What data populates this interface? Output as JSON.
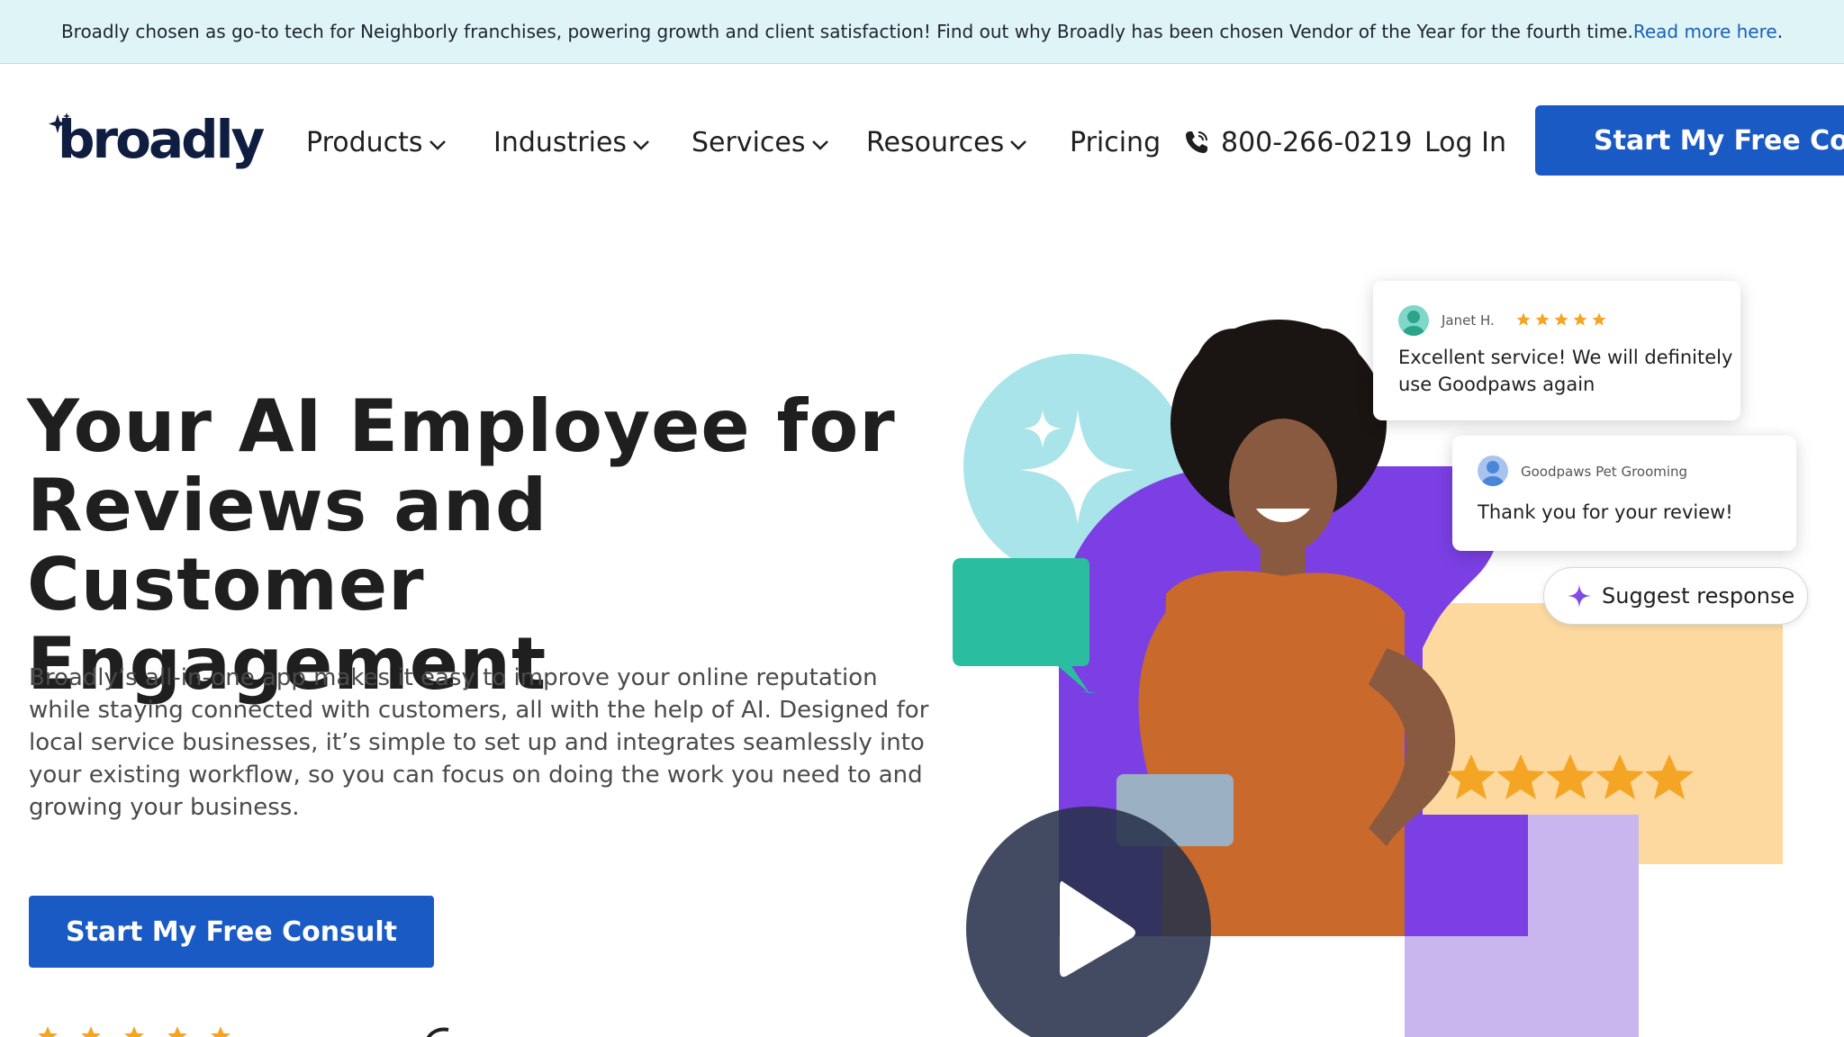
{
  "banner": {
    "text": "Broadly chosen as go-to tech for Neighborly franchises, powering growth and client satisfaction! Find out why Broadly has been chosen Vendor of the Year for the fourth time. ",
    "link": "Read more here",
    "suffix": "."
  },
  "nav": {
    "logo_text": "broadly",
    "items": [
      {
        "label": "Products"
      },
      {
        "label": "Industries"
      },
      {
        "label": "Services"
      },
      {
        "label": "Resources"
      },
      {
        "label": "Pricing"
      }
    ],
    "phone": "800-266-0219",
    "login": "Log In",
    "cta": "Start My Free Consult"
  },
  "hero": {
    "headline_lines": [
      "Your AI Employee for",
      "Reviews and Customer",
      "Engagement"
    ],
    "subcopy": "Broadly’s all-in-one app makes it easy to improve your online reputation while staying connected with customers, all with the help of AI. Designed for local service businesses, it’s simple to set up and integrates seamlessly into your existing workflow, so you can focus on doing the work you need to and growing your business.",
    "cta": "Start My Free Consult"
  },
  "illustration": {
    "review_card": {
      "name": "Janet H.",
      "rating": 5,
      "text_line1": "Excellent service! We will definitely",
      "text_line2": "use Goodpaws again"
    },
    "reply_card": {
      "name": "Goodpaws Pet Grooming",
      "text": "Thank you for your review!"
    },
    "suggest_button": "Suggest response",
    "big_stars": 5
  },
  "colors": {
    "banner_bg": "#dff4f6",
    "primary": "#1a5ac4",
    "logo": "#0f1d40",
    "star": "#f5a524",
    "purple": "#7b3fe4",
    "lavender": "#c9b6ee",
    "teal": "#2bbd9f",
    "light_teal": "#a9e4ea",
    "peach": "#fdd9a0"
  },
  "icons": [
    "spark-icon",
    "chevron-down-icon",
    "phone-icon",
    "star-icon",
    "play-icon",
    "sparkle-ai-icon",
    "user-avatar-icon"
  ]
}
